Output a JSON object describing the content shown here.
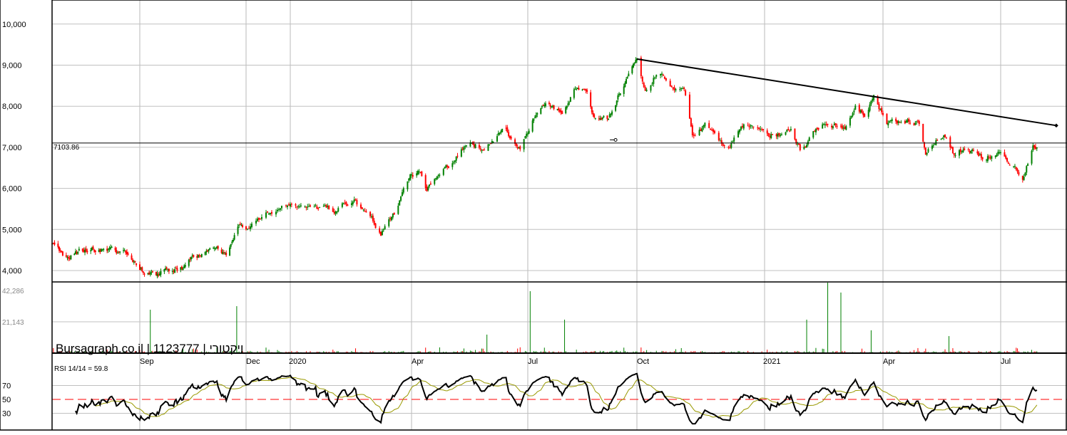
{
  "chart_data": [
    {
      "type": "candlestick",
      "title": "",
      "yaxis_ticks": [
        "4,000",
        "5,000",
        "6,000",
        "7,000",
        "8,000",
        "9,000",
        "10,000"
      ],
      "ylim": [
        3600,
        10600
      ],
      "grid": true,
      "x_ticks": [
        {
          "label": "Sep",
          "date": "2019-09-01"
        },
        {
          "label": "Dec",
          "date": "2019-12-01"
        },
        {
          "label": "2020",
          "date": "2020-01-01"
        },
        {
          "label": "Apr",
          "date": "2020-04-01"
        },
        {
          "label": "Jul",
          "date": "2020-07-01"
        },
        {
          "label": "Oct",
          "date": "2020-10-01"
        },
        {
          "label": "2021",
          "date": "2021-01-01"
        },
        {
          "label": "Apr",
          "date": "2021-04-01"
        },
        {
          "label": "Jul",
          "date": "2021-07-01"
        }
      ],
      "approx_close_path": [
        [
          "2019-06-18",
          4600
        ],
        [
          "2019-06-27",
          4350
        ],
        [
          "2019-07-20",
          4550
        ],
        [
          "2019-08-22",
          4420
        ],
        [
          "2019-09-03",
          4050
        ],
        [
          "2019-09-15",
          3900
        ],
        [
          "2019-10-03",
          4000
        ],
        [
          "2019-10-15",
          4300
        ],
        [
          "2019-11-03",
          4520
        ],
        [
          "2019-11-15",
          4350
        ],
        [
          "2019-11-25",
          5100
        ],
        [
          "2019-12-03",
          4950
        ],
        [
          "2019-12-18",
          5450
        ],
        [
          "2019-12-29",
          5600
        ],
        [
          "2020-01-13",
          5550
        ],
        [
          "2020-02-03",
          5450
        ],
        [
          "2020-02-18",
          5750
        ],
        [
          "2020-03-01",
          5250
        ],
        [
          "2020-03-09",
          4900
        ],
        [
          "2020-03-20",
          5400
        ],
        [
          "2020-03-31",
          6300
        ],
        [
          "2020-04-08",
          6400
        ],
        [
          "2020-04-13",
          6000
        ],
        [
          "2020-04-24",
          6400
        ],
        [
          "2020-05-05",
          6700
        ],
        [
          "2020-05-16",
          7200
        ],
        [
          "2020-05-27",
          6950
        ],
        [
          "2020-06-13",
          7400
        ],
        [
          "2020-06-25",
          6900
        ],
        [
          "2020-07-06",
          7700
        ],
        [
          "2020-07-18",
          8100
        ],
        [
          "2020-07-30",
          7900
        ],
        [
          "2020-08-12",
          8500
        ],
        [
          "2020-08-20",
          8400
        ],
        [
          "2020-08-26",
          7700
        ],
        [
          "2020-09-07",
          7700
        ],
        [
          "2020-09-19",
          8500
        ],
        [
          "2020-10-01",
          9100
        ],
        [
          "2020-10-07",
          8400
        ],
        [
          "2020-10-17",
          8900
        ],
        [
          "2020-10-25",
          8500
        ],
        [
          "2020-11-04",
          8500
        ],
        [
          "2020-11-10",
          7300
        ],
        [
          "2020-11-19",
          7500
        ],
        [
          "2020-12-05",
          6900
        ],
        [
          "2020-12-15",
          7500
        ],
        [
          "2020-12-25",
          7600
        ],
        [
          "2021-01-05",
          7300
        ],
        [
          "2021-01-21",
          7400
        ],
        [
          "2021-01-29",
          6900
        ],
        [
          "2021-02-06",
          7300
        ],
        [
          "2021-02-17",
          7600
        ],
        [
          "2021-03-03",
          7500
        ],
        [
          "2021-03-11",
          8100
        ],
        [
          "2021-03-19",
          7800
        ],
        [
          "2021-03-25",
          8200
        ],
        [
          "2021-04-04",
          7600
        ],
        [
          "2021-04-18",
          7600
        ],
        [
          "2021-04-29",
          7600
        ],
        [
          "2021-05-04",
          6800
        ],
        [
          "2021-05-13",
          7200
        ],
        [
          "2021-05-18",
          7300
        ],
        [
          "2021-05-26",
          6800
        ],
        [
          "2021-06-04",
          7000
        ],
        [
          "2021-06-18",
          6700
        ],
        [
          "2021-06-29",
          6900
        ],
        [
          "2021-07-10",
          6600
        ],
        [
          "2021-07-18",
          6300
        ],
        [
          "2021-07-26",
          7000
        ],
        [
          "2021-07-31",
          6950
        ]
      ],
      "up_color": "#008000",
      "down_color": "#ff0000",
      "horizontal_line": {
        "value": 7103.86,
        "label": "7103.86"
      },
      "trendline": {
        "from": [
          "2020-10-01",
          9150
        ],
        "to": [
          "2021-08-13",
          7530
        ]
      },
      "marker": [
        "2020-09-13",
        7180
      ]
    },
    {
      "type": "bar",
      "yaxis_ticks": [
        "21,143",
        "42,286"
      ],
      "ylim": [
        0,
        42286
      ],
      "spikes": [
        [
          "2019-09-10",
          29300
        ],
        [
          "2019-11-23",
          31700
        ],
        [
          "2020-05-30",
          12500
        ],
        [
          "2020-07-03",
          41800
        ],
        [
          "2020-08-01",
          22600
        ],
        [
          "2021-02-02",
          22600
        ],
        [
          "2021-02-18",
          47600
        ],
        [
          "2021-02-28",
          40900
        ],
        [
          "2021-03-23",
          15400
        ],
        [
          "2021-05-22",
          11500
        ]
      ]
    },
    {
      "type": "line",
      "label": "RSI 14/14 = 59.8",
      "yaxis_ticks": [
        "30",
        "50",
        "70"
      ],
      "ylim": [
        10,
        100
      ],
      "series": [
        {
          "color": "#000000"
        },
        {
          "color": "#999900"
        }
      ],
      "midline_color": "#ff0000"
    }
  ],
  "watermark": "Bursagraph.co.il | 1123777 | ויקטורי"
}
